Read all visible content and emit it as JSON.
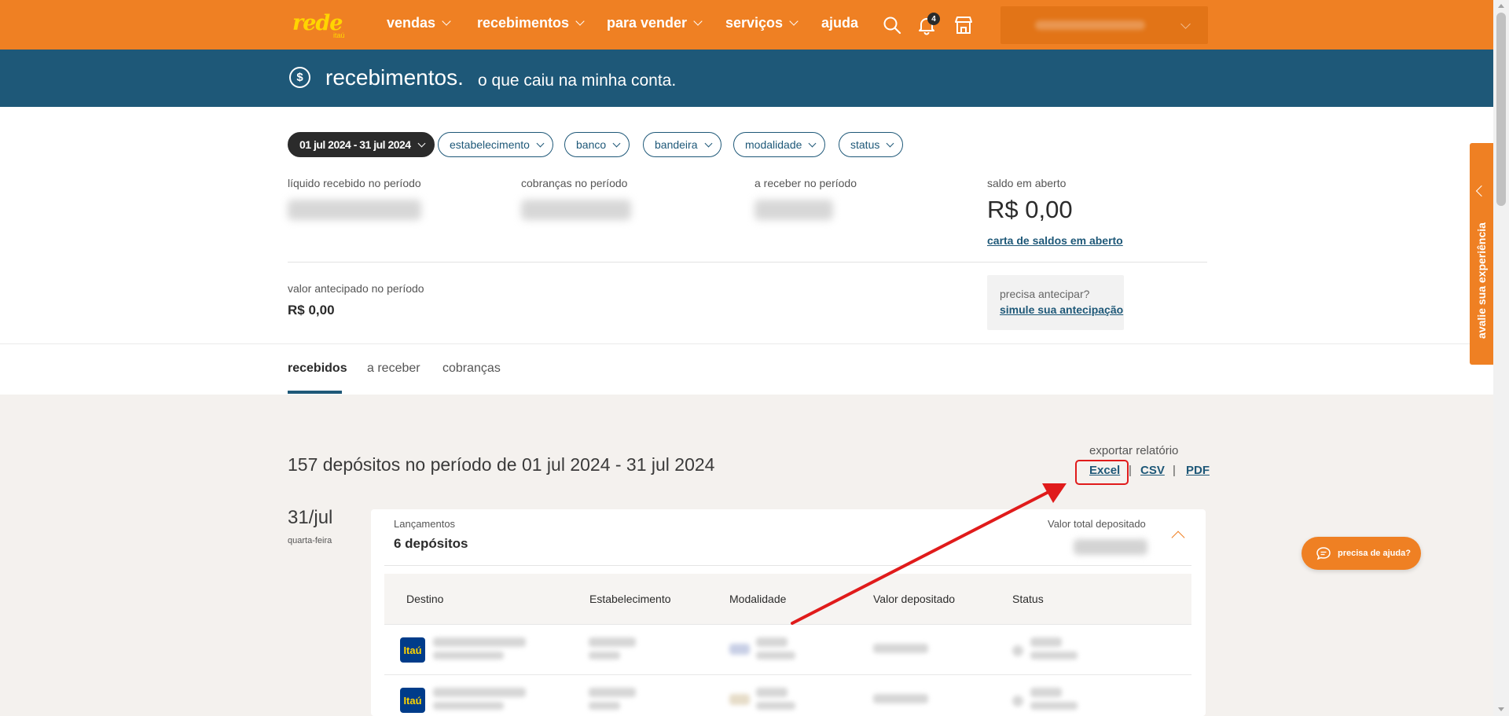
{
  "brand": {
    "name": "rede",
    "sub": "itaú"
  },
  "nav": {
    "items": [
      {
        "label": "vendas"
      },
      {
        "label": "recebimentos"
      },
      {
        "label": "para vender"
      },
      {
        "label": "serviços"
      },
      {
        "label": "ajuda"
      }
    ],
    "notifications_count": "4",
    "icons": [
      "search-icon",
      "bell-icon",
      "store-icon"
    ]
  },
  "header": {
    "title": "recebimentos.",
    "subtitle": "o que caiu na minha conta.",
    "icon": "$"
  },
  "filters": {
    "period": "01 jul 2024 - 31 jul 2024",
    "items": [
      "estabelecimento",
      "banco",
      "bandeira",
      "modalidade",
      "status"
    ]
  },
  "summary": {
    "liquido_label": "líquido recebido no período",
    "cobrancas_label": "cobranças no período",
    "areceber_label": "a receber no período",
    "saldo_label": "saldo em aberto",
    "saldo_value": "R$ 0,00",
    "saldo_link": "carta de saldos em aberto",
    "antecipado_label": "valor antecipado no período",
    "antecipado_value": "R$ 0,00",
    "antecipar_question": "precisa antecipar?",
    "antecipar_link": "simule sua antecipação"
  },
  "tabs": [
    "recebidos",
    "a receber",
    "cobranças"
  ],
  "deposits": {
    "title": "157 depósitos no período de 01 jul 2024 - 31 jul 2024",
    "export_label": "exportar relatório",
    "export_options": [
      "Excel",
      "CSV",
      "PDF"
    ],
    "export_separator": "|",
    "day": "31/jul",
    "weekday": "quarta-feira",
    "lancamentos_label": "Lançamentos",
    "lancamentos_value": "6 depósitos",
    "total_label": "Valor total depositado",
    "columns": [
      "Destino",
      "Estabelecimento",
      "Modalidade",
      "Valor depositado",
      "Status"
    ],
    "bank_logo_text": "Itaú"
  },
  "side_tab": "avalie sua experiência",
  "help_button": "precisa de ajuda?",
  "colors": {
    "primary_orange": "#ef8023",
    "dark_blue": "#1e5878",
    "highlight_red": "#e01b1b"
  }
}
